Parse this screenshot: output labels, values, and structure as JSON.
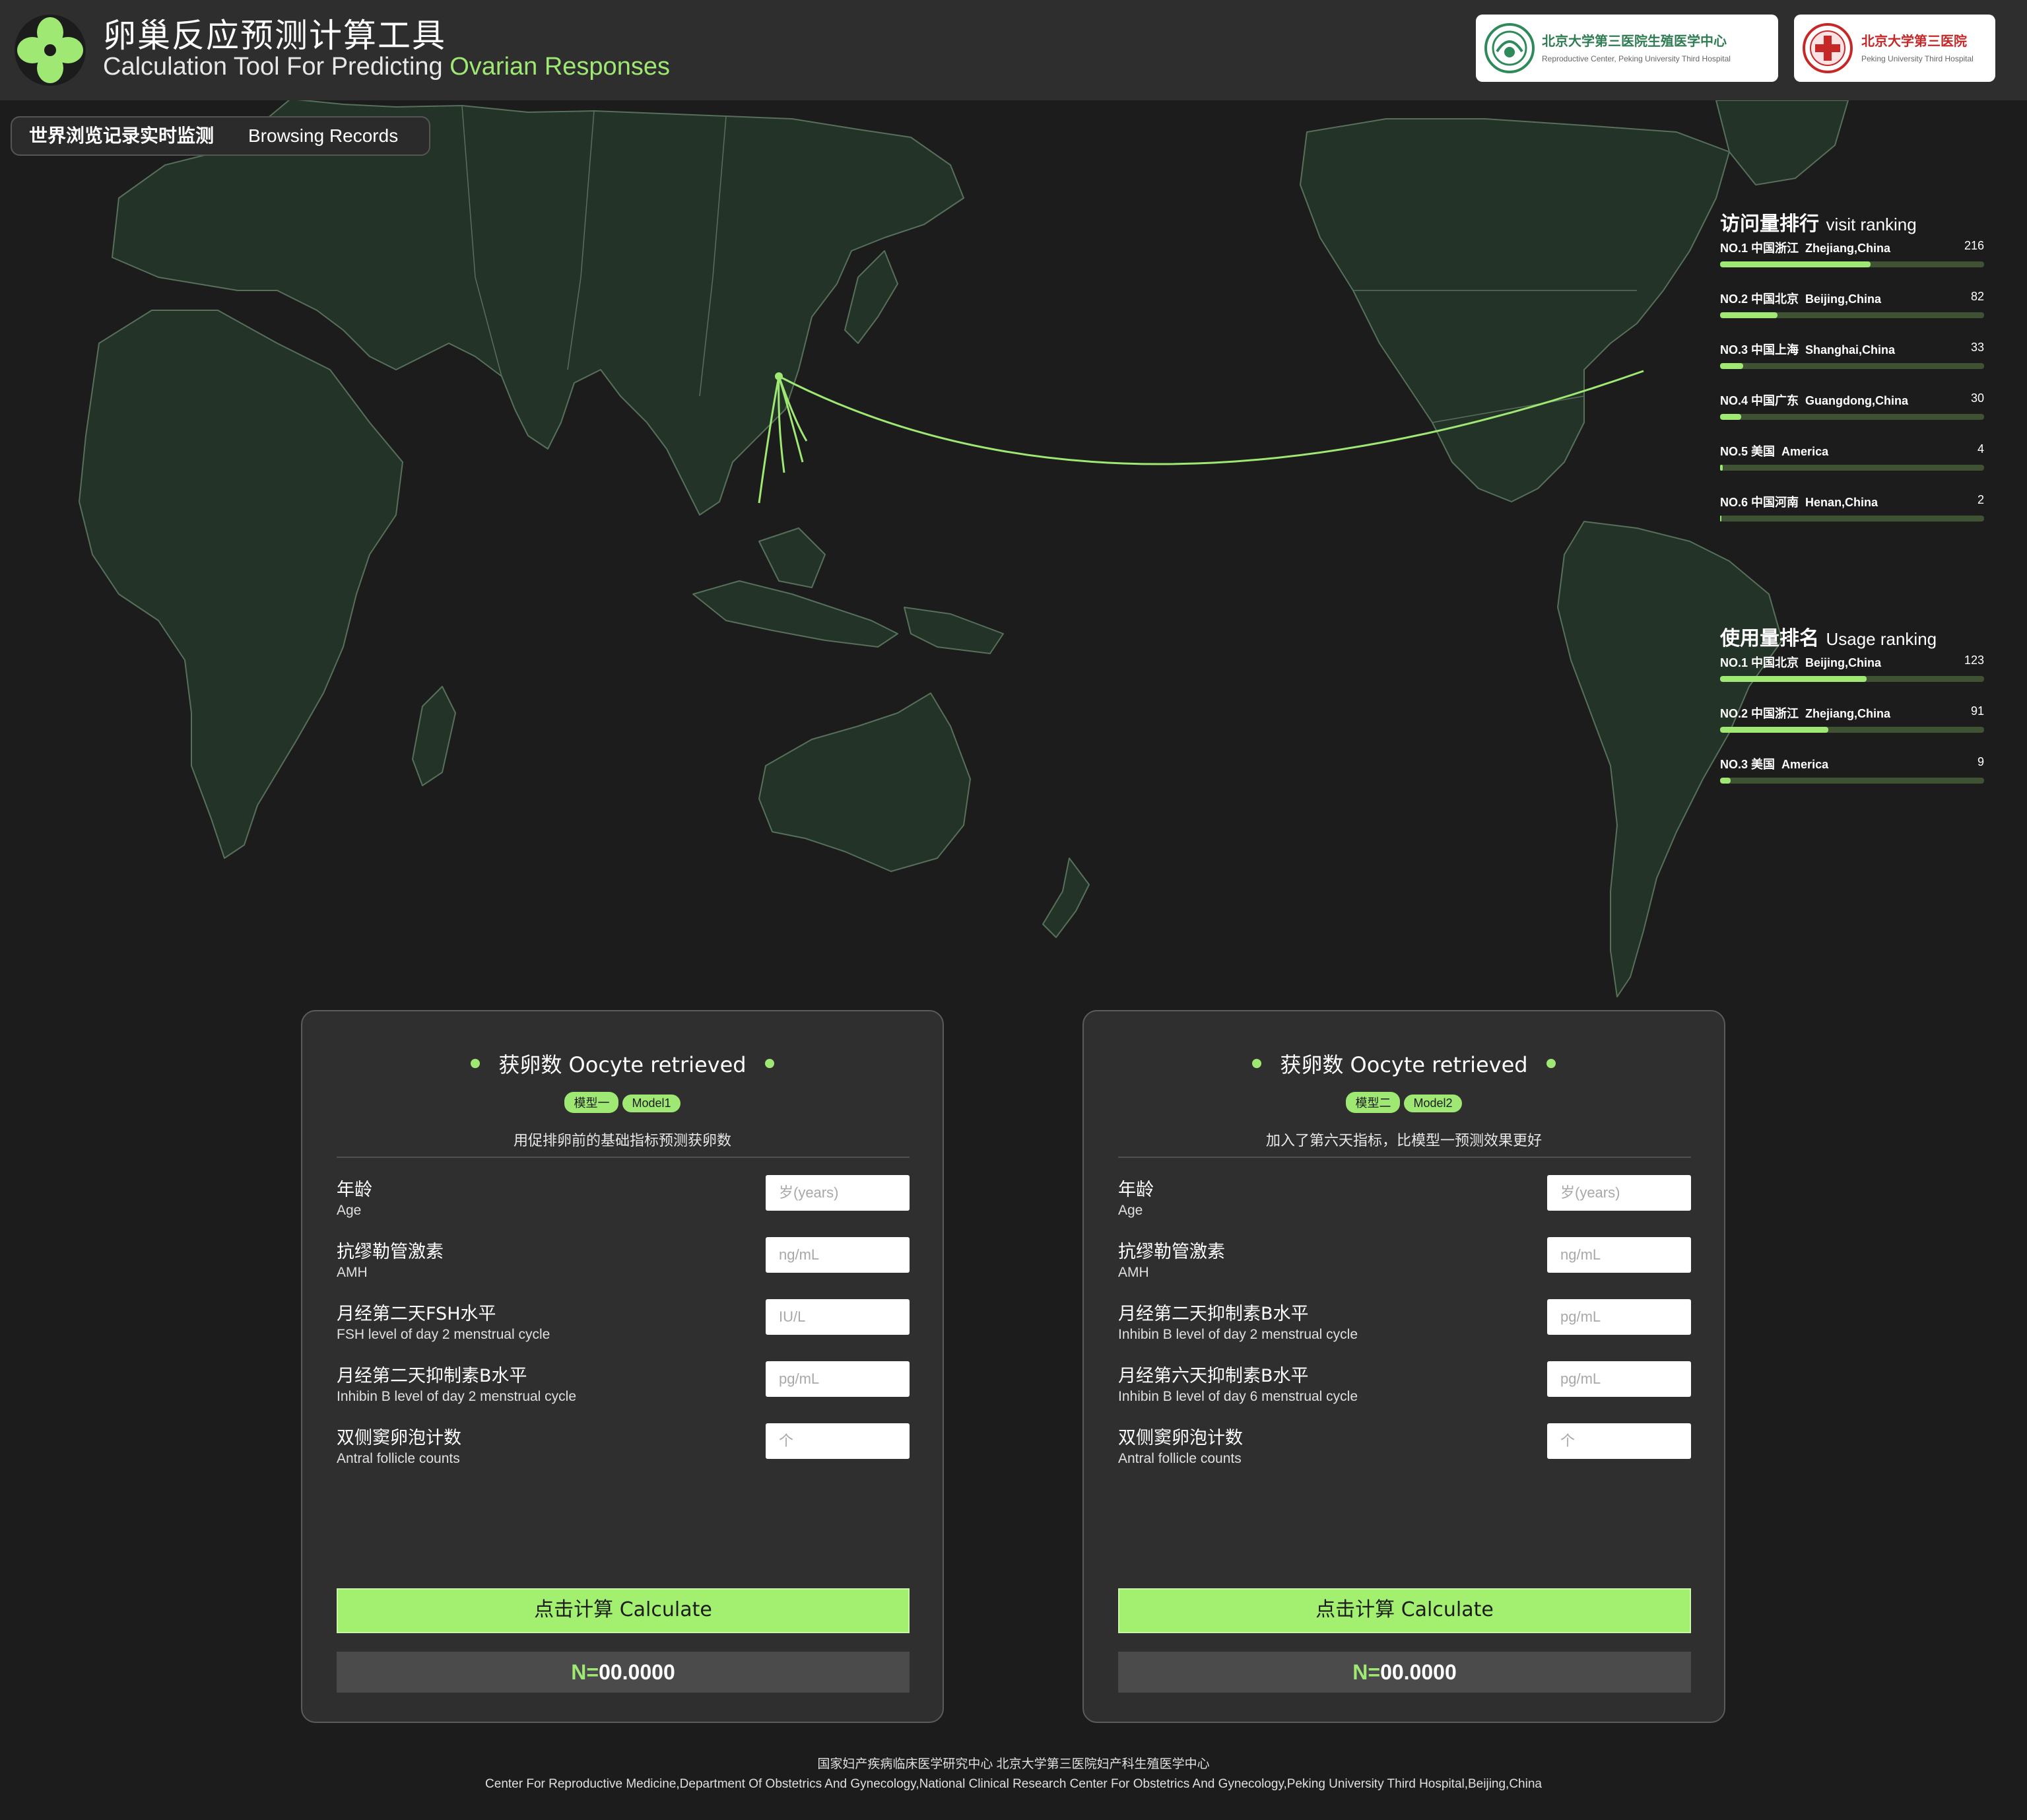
{
  "header": {
    "title_cn": "卵巢反应预测计算工具",
    "title_en_prefix": "Calculation Tool For Predicting ",
    "title_en_highlight": "Ovarian Responses",
    "logos": [
      {
        "name_cn": "北京大学第三医院生殖医学中心",
        "name_en": "Reproductive Center, Peking University Third Hospital"
      },
      {
        "name_cn": "北京大学第三医院",
        "name_en": "Peking University Third Hospital"
      }
    ]
  },
  "map": {
    "tab_cn": "世界浏览记录实时监测",
    "tab_en": "Browsing Records",
    "visit_ranking": {
      "title_cn": "访问量排行",
      "title_en": "visit ranking",
      "items": [
        {
          "rank": "NO.1",
          "region_cn": "中国浙江",
          "region_en": "Zhejiang,China",
          "count": 216
        },
        {
          "rank": "NO.2",
          "region_cn": "中国北京",
          "region_en": "Beijing,China",
          "count": 82
        },
        {
          "rank": "NO.3",
          "region_cn": "中国上海",
          "region_en": "Shanghai,China",
          "count": 33
        },
        {
          "rank": "NO.4",
          "region_cn": "中国广东",
          "region_en": "Guangdong,China",
          "count": 30
        },
        {
          "rank": "NO.5",
          "region_cn": "美国",
          "region_en": "America",
          "count": 4
        },
        {
          "rank": "NO.6",
          "region_cn": "中国河南",
          "region_en": "Henan,China",
          "count": 2
        }
      ]
    },
    "usage_ranking": {
      "title_cn": "使用量排名",
      "title_en": "Usage ranking",
      "items": [
        {
          "rank": "NO.1",
          "region_cn": "中国北京",
          "region_en": "Beijing,China",
          "count": 123
        },
        {
          "rank": "NO.2",
          "region_cn": "中国浙江",
          "region_en": "Zhejiang,China",
          "count": 91
        },
        {
          "rank": "NO.3",
          "region_cn": "美国",
          "region_en": "America",
          "count": 9
        }
      ]
    }
  },
  "cards": [
    {
      "title": "获卵数 Oocyte retrieved",
      "tag_cn": "模型一",
      "tag_en": "Model1",
      "description": "用促排卵前的基础指标预测获卵数",
      "fields": [
        {
          "label_cn": "年龄",
          "label_en": "Age",
          "placeholder": "岁(years)",
          "value": ""
        },
        {
          "label_cn": "抗缪勒管激素",
          "label_en": "AMH",
          "placeholder": "ng/mL",
          "value": ""
        },
        {
          "label_cn": "月经第二天FSH水平",
          "label_en": "FSH level of day 2 menstrual cycle",
          "placeholder": "IU/L",
          "value": ""
        },
        {
          "label_cn": "月经第二天抑制素B水平",
          "label_en": "Inhibin B level of day 2 menstrual cycle",
          "placeholder": "pg/mL",
          "value": ""
        },
        {
          "label_cn": "双侧窦卵泡计数",
          "label_en": "Antral follicle counts",
          "placeholder": "个",
          "value": ""
        }
      ],
      "button": "点击计算 Calculate",
      "result_label": "N=",
      "result_value": "00.0000"
    },
    {
      "title": "获卵数 Oocyte retrieved",
      "tag_cn": "模型二",
      "tag_en": "Model2",
      "description": "加入了第六天指标，比模型一预测效果更好",
      "fields": [
        {
          "label_cn": "年龄",
          "label_en": "Age",
          "placeholder": "岁(years)",
          "value": ""
        },
        {
          "label_cn": "抗缪勒管激素",
          "label_en": "AMH",
          "placeholder": "ng/mL",
          "value": ""
        },
        {
          "label_cn": "月经第二天抑制素B水平",
          "label_en": "Inhibin B level of day 2 menstrual cycle",
          "placeholder": "pg/mL",
          "value": ""
        },
        {
          "label_cn": "月经第六天抑制素B水平",
          "label_en": "Inhibin B level of day 6 menstrual cycle",
          "placeholder": "pg/mL",
          "value": ""
        },
        {
          "label_cn": "双侧窦卵泡计数",
          "label_en": "Antral follicle counts",
          "placeholder": "个",
          "value": ""
        }
      ],
      "button": "点击计算 Calculate",
      "result_label": "N=",
      "result_value": "00.0000"
    }
  ],
  "footer": {
    "line1": "国家妇产疾病临床医学研究中心 北京大学第三医院妇产科生殖医学中心",
    "line2": "Center For Reproductive Medicine,Department Of Obstetrics And Gynecology,National Clinical Research Center For Obstetrics And Gynecology,Peking University Third Hospital,Beijing,China"
  },
  "colors": {
    "accent": "#9ee873",
    "background": "#1c1c1c",
    "header": "#2d2e2d",
    "card": "#2e2f2e",
    "land": "#243328",
    "bar_track": "#3f5233"
  }
}
